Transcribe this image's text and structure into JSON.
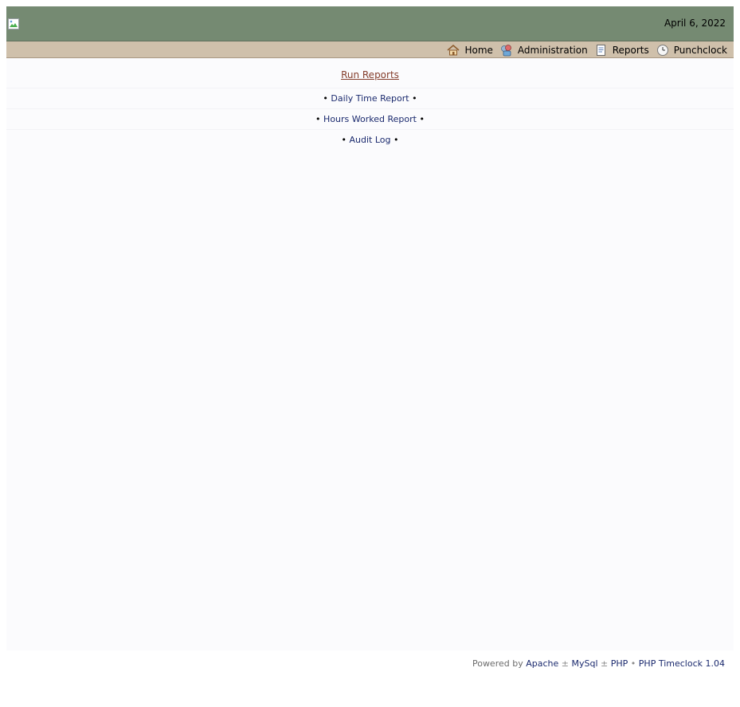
{
  "header": {
    "date": "April 6, 2022"
  },
  "nav": {
    "items": [
      {
        "label": "Home",
        "icon": "home-icon"
      },
      {
        "label": "Administration",
        "icon": "admin-icon"
      },
      {
        "label": "Reports",
        "icon": "report-icon"
      },
      {
        "label": "Punchclock",
        "icon": "clock-icon"
      }
    ]
  },
  "main": {
    "title": "Run Reports",
    "reports": [
      {
        "label": "Daily Time Report"
      },
      {
        "label": "Hours Worked Report"
      },
      {
        "label": "Audit Log"
      }
    ],
    "bullet": "•"
  },
  "footer": {
    "prefix": "Powered by",
    "apache": "Apache",
    "sep1": "±",
    "mysql": "MySql",
    "sep2": "±",
    "php": "PHP",
    "sep3": "•",
    "timeclock": "PHP Timeclock 1.04"
  },
  "colors": {
    "header_bg": "#758a72",
    "navbar_bg": "#cfc0ab",
    "content_bg": "#fbfbfd",
    "title_link": "#853e2c",
    "link": "#1b2a6e"
  }
}
